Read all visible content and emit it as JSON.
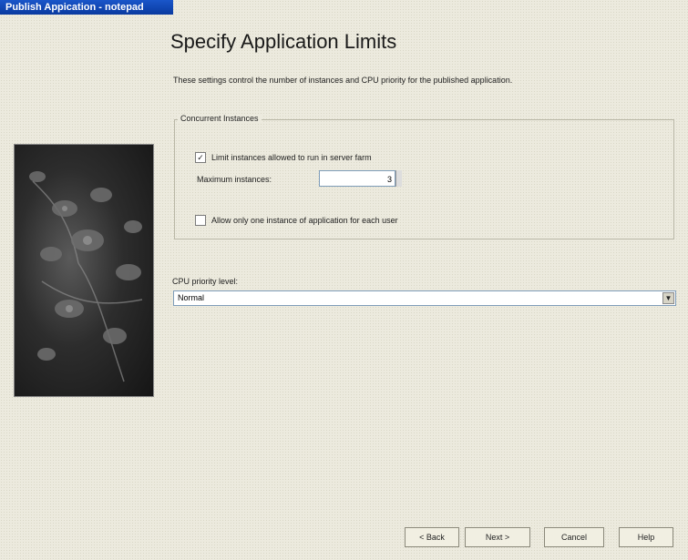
{
  "window": {
    "title": "Publish Appication - notepad"
  },
  "header": {
    "title": "Specify Application Limits",
    "description": "These settings control the number of instances and CPU priority for the published application."
  },
  "concurrent": {
    "legend": "Concurrent Instances",
    "limit_label": "Limit instances allowed to run in server farm",
    "limit_checked": true,
    "limit_mark": "✓",
    "max_label": "Maximum instances:",
    "max_value": "3",
    "one_per_user_label": "Allow only one instance of application for each user",
    "one_per_user_checked": false
  },
  "cpu": {
    "label": "CPU priority level:",
    "value": "Normal",
    "arrow": "▼"
  },
  "buttons": {
    "back": "< Back",
    "next": "Next >",
    "cancel": "Cancel",
    "help": "Help"
  }
}
